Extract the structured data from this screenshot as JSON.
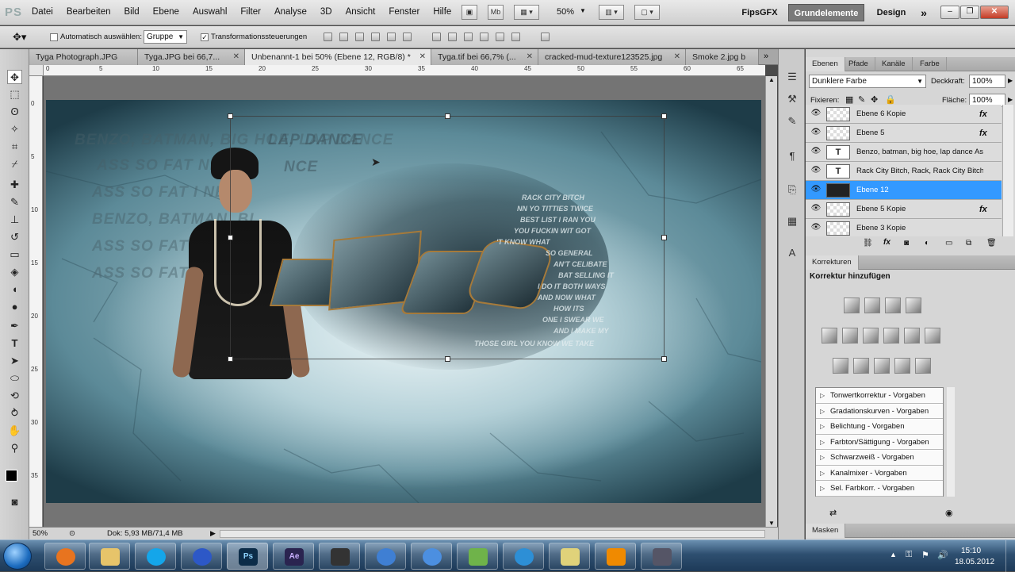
{
  "menubar": {
    "app_logo": "PS",
    "items": [
      "Datei",
      "Bearbeiten",
      "Bild",
      "Ebene",
      "Auswahl",
      "Filter",
      "Analyse",
      "3D",
      "Ansicht",
      "Fenster",
      "Hilfe"
    ],
    "zoom": "50%",
    "workspace_user": "FipsGFX",
    "workspace_active": "Grundelemente",
    "workspace_design": "Design",
    "more": "»"
  },
  "optionsbar": {
    "auto_select_label": "Automatisch auswählen:",
    "auto_select_value": "Gruppe",
    "transform_label": "Transformationssteuerungen"
  },
  "doc_tabs": [
    {
      "label": "Tyga Photograph.JPG",
      "active": false
    },
    {
      "label": "Tyga.JPG bei 66,7...",
      "active": false
    },
    {
      "label": "Unbenannt-1 bei 50% (Ebene 12, RGB/8) *",
      "active": true
    },
    {
      "label": "Tyga.tif bei 66,7% (...",
      "active": false
    },
    {
      "label": "cracked-mud-texture123525.jpg",
      "active": false
    },
    {
      "label": "Smoke 2.jpg b",
      "active": false
    }
  ],
  "ruler_h": [
    "0",
    "5",
    "10",
    "15",
    "20",
    "25",
    "30",
    "35",
    "40",
    "45",
    "50",
    "55",
    "60",
    "65"
  ],
  "ruler_v": [
    "0",
    "5",
    "10",
    "15",
    "20",
    "25",
    "30",
    "35"
  ],
  "artwork": {
    "bg_lines": [
      "BENZO, BATMAN, BIG HOE, LAP DANCE",
      "ASS SO FAT NEED",
      "ASS SO FAT I NE",
      "BENZO, BATMAN, BI",
      "ASS SO FAT",
      "ASS SO FAT"
    ],
    "top_lines": [
      "LAP DANCE",
      "NCE"
    ],
    "lyrics": [
      "RACK CITY BITCH",
      "NN YO TITTIES TWICE",
      "BEST LIST I RAN YOU",
      "YOU FUCKIN WIT GOT",
      "'T KNOW WHAT",
      "SO GENERAL",
      "AN'T CELIBATE",
      "BAT SELLING IT",
      "I DO IT BOTH WAYS",
      "AND NOW WHAT",
      "HOW ITS",
      "ONE I SWEAR WE",
      "AND I MAKE MY",
      "THOSE GIRL YOU KNOW WE TAKE"
    ]
  },
  "statusbar": {
    "zoom": "50%",
    "doc_info": "Dok: 5,93 MB/71,4 MB"
  },
  "layers_panel": {
    "tabs": [
      "Ebenen",
      "Pfade",
      "Kanäle",
      "Farbe"
    ],
    "blend_mode": "Dunklere Farbe",
    "opacity_label": "Deckkraft:",
    "opacity_value": "100%",
    "lock_label": "Fixieren:",
    "fill_label": "Fläche:",
    "fill_value": "100%",
    "layers": [
      {
        "name": "Ebene 6 Kopie",
        "fx": "fx",
        "type": "pixel",
        "selected": false
      },
      {
        "name": "Ebene 5",
        "fx": "fx",
        "type": "pixel",
        "selected": false
      },
      {
        "name": "Benzo, batman, big hoe, lap dance Ass...",
        "fx": "",
        "type": "text",
        "selected": false
      },
      {
        "name": "Rack City Bitch, Rack, Rack City Bitch ...",
        "fx": "",
        "type": "text",
        "selected": false
      },
      {
        "name": "Ebene 12",
        "fx": "",
        "type": "pixel",
        "selected": true
      },
      {
        "name": "Ebene 5 Kopie",
        "fx": "fx",
        "type": "pixel",
        "selected": false
      },
      {
        "name": "Ebene 3 Kopie",
        "fx": "",
        "type": "pixel",
        "selected": false
      }
    ],
    "text_thumb": "T"
  },
  "adjustments_panel": {
    "tab": "Korrekturen",
    "heading": "Korrektur hinzufügen",
    "presets": [
      "Tonwertkorrektur - Vorgaben",
      "Gradationskurven - Vorgaben",
      "Belichtung - Vorgaben",
      "Farbton/Sättigung - Vorgaben",
      "Schwarzweiß - Vorgaben",
      "Kanalmixer - Vorgaben",
      "Sel. Farbkorr. - Vorgaben"
    ]
  },
  "masks_panel": {
    "tab": "Masken"
  },
  "taskbar": {
    "apps": [
      "Firefox",
      "Explorer",
      "Skype",
      "Media",
      "Ps",
      "Ae",
      "Terminal",
      "Network",
      "iTunes",
      "Editor",
      "Browser",
      "Files",
      "VLC",
      "Tools"
    ],
    "time": "15:10",
    "date": "18.05.2012"
  }
}
